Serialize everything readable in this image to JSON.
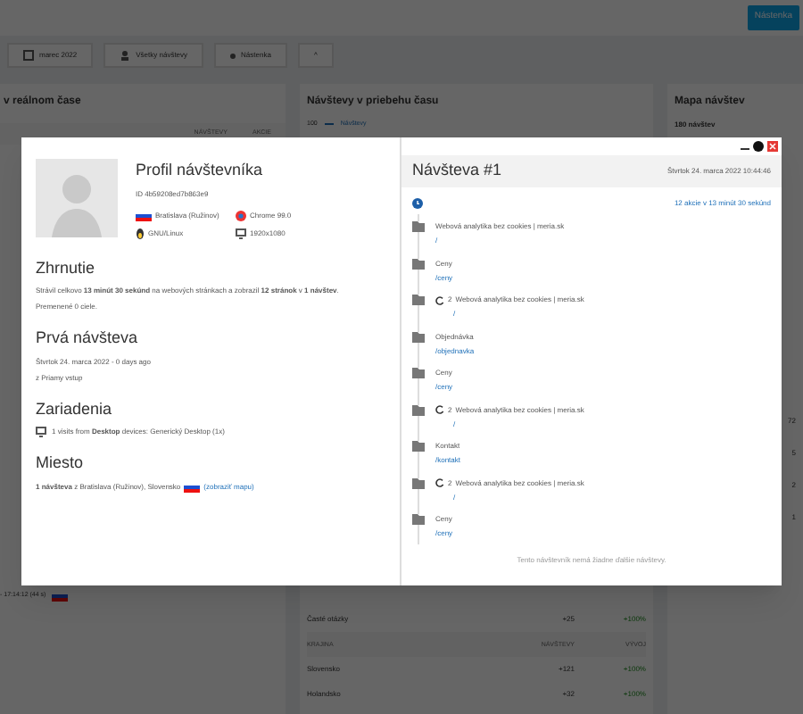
{
  "background": {
    "top_button": "Nástenka",
    "toolbar": [
      {
        "kind": "calendar",
        "label": "marec 2022"
      },
      {
        "kind": "filter",
        "label": "Všetky návštevy"
      },
      {
        "kind": "dot",
        "label": "Nástenka"
      },
      {
        "kind": "up",
        "label": "^"
      }
    ],
    "panels": [
      {
        "title": "v reálnom čase",
        "columns": [
          "NÁVŠTEVY",
          "AKCIE"
        ],
        "visit_time": "- 17:14:12 (44 s)"
      },
      {
        "title": "Návštevy v priebehu času",
        "axis_label": "100",
        "legend": "Návštevy",
        "rows": [
          {
            "label": "Časté otázky",
            "visits": "+25",
            "change": "+100%",
            "kind": "row"
          },
          {
            "label": "KRAJINA",
            "visits": "NÁVŠTEVY",
            "change": "VÝVOJ",
            "kind": "header"
          },
          {
            "label": "Slovensko",
            "visits": "+121",
            "change": "+100%",
            "kind": "row"
          },
          {
            "label": "Holandsko",
            "visits": "+32",
            "change": "+100%",
            "kind": "row"
          }
        ]
      },
      {
        "title": "Mapa návštev",
        "count": "180 návštev",
        "values": [
          "72",
          "5",
          "2",
          "1"
        ]
      }
    ]
  },
  "modal": {
    "profile": {
      "title": "Profil návštevníka",
      "id": "ID 4b59208ed7b863e9",
      "location": "Bratislava (Ružinov)",
      "browser": "Chrome 99.0",
      "os": "GNU/Linux",
      "resolution": "1920x1080"
    },
    "summary": {
      "title": "Zhrnutie",
      "text": "Strávil celkovo **13 minút 30 sekúnd** na webových stránkach a zobrazil **12 stránok** v **1 návštev**.",
      "goals": "Premenené 0 ciele."
    },
    "first_visit": {
      "title": "Prvá návšteva",
      "date": "Štvrtok 24. marca 2022 - 0 days ago",
      "source": "z Priamy vstup"
    },
    "devices": {
      "title": "Zariadenia",
      "text": "1 visits from **Desktop** devices: Generický Desktop (1x)"
    },
    "place": {
      "title": "Miesto",
      "text": "**1 návšteva** z Bratislava (Ružinov), Slovensko",
      "map_link": "(zobraziť mapu)"
    },
    "visit": {
      "title": "Návšteva #1",
      "date": "Štvrtok 24. marca 2022 10:44:46",
      "summary": "12 akcie v 13 minút 30 sekúnd",
      "timeline": [
        {
          "kind": "page",
          "title": "Webová analytika bez cookies | meria.sk",
          "path": "/"
        },
        {
          "kind": "page",
          "title": "Ceny",
          "path": "/ceny"
        },
        {
          "kind": "reload",
          "count": "2",
          "title": "Webová analytika bez cookies | meria.sk",
          "path": "/"
        },
        {
          "kind": "page",
          "title": "Objednávka",
          "path": "/objednavka"
        },
        {
          "kind": "page",
          "title": "Ceny",
          "path": "/ceny"
        },
        {
          "kind": "reload",
          "count": "2",
          "title": "Webová analytika bez cookies | meria.sk",
          "path": "/"
        },
        {
          "kind": "page",
          "title": "Kontakt",
          "path": "/kontakt"
        },
        {
          "kind": "reload",
          "count": "2",
          "title": "Webová analytika bez cookies | meria.sk",
          "path": "/"
        },
        {
          "kind": "page",
          "title": "Ceny",
          "path": "/ceny"
        }
      ],
      "footer": "Tento návštevník nemá žiadne ďalšie návštevy."
    }
  }
}
